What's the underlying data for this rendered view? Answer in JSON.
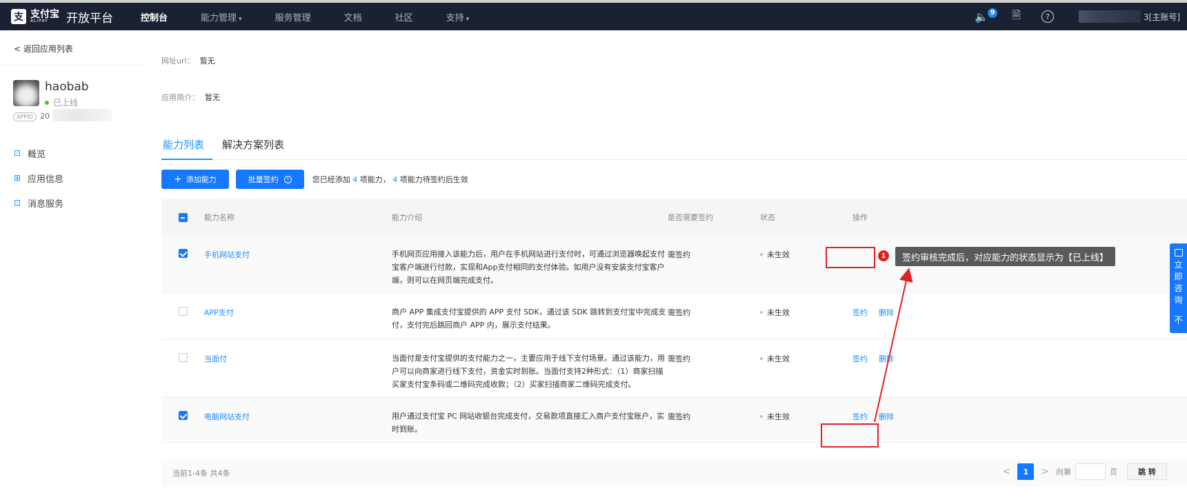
{
  "topbar": {
    "logo_mark": "支",
    "logo_zh": "支付宝",
    "logo_en": "ALIPAY",
    "platform": "开放平台",
    "nav": [
      {
        "label": "控制台",
        "caret": false,
        "active": true
      },
      {
        "label": "能力管理",
        "caret": true,
        "active": false
      },
      {
        "label": "服务管理",
        "caret": false,
        "active": false
      },
      {
        "label": "文档",
        "caret": false,
        "active": false
      },
      {
        "label": "社区",
        "caret": false,
        "active": false
      },
      {
        "label": "支持",
        "caret": true,
        "active": false
      }
    ],
    "notification_count": "9",
    "account_suffix": "3[主账号]",
    "speaker_glyph": "🔈",
    "doc_glyph": "🗎",
    "help_glyph": "?",
    "caret_glyph": "▾"
  },
  "sidebar": {
    "back_label": "返回应用列表",
    "back_glyph": "<",
    "app_name": "haobab",
    "app_status": "已上线",
    "appid_badge": "APPID",
    "appid_prefix": "20",
    "menu": [
      {
        "label": "概览",
        "icon": "monitor-icon",
        "glyph": "⊡"
      },
      {
        "label": "应用信息",
        "icon": "grid-icon",
        "glyph": "⊞"
      },
      {
        "label": "消息服务",
        "icon": "message-monitor-icon",
        "glyph": "⊡"
      }
    ]
  },
  "main": {
    "url_label": "网址url：",
    "url_value": "暂无",
    "intro_label": "应用简介：",
    "intro_value": "暂无",
    "tabs": [
      "能力列表",
      "解决方案列表"
    ],
    "add_button": "添加能力",
    "add_glyph": "+",
    "batch_button": "批量签约",
    "batch_glyph": "!",
    "summary_pre": "您已经添加",
    "summary_count1": "4",
    "summary_mid": "项能力，",
    "summary_count2": "4",
    "summary_post": "项能力待签约后生效",
    "columns": [
      "能力名称",
      "能力介绍",
      "是否需要签约",
      "状态",
      "操作"
    ],
    "rows": [
      {
        "name": "手机网站支付",
        "desc": "手机网页应用接入该能力后，用户在手机网站进行支付时，可通过浏览器唤起支付宝客户端进行付款，实现和App支付相同的支付体验。如用户没有安装支付宝客户端，则可以在网页端完成支付。",
        "sign": "需签约",
        "status": "未生效",
        "checked": true,
        "ops": []
      },
      {
        "name": "APP支付",
        "desc": "商户 APP 集成支付宝提供的 APP 支付 SDK，通过该 SDK 跳转到支付宝中完成支付，支付完后跳回商户 APP 内，展示支付结果。",
        "sign": "需签约",
        "status": "未生效",
        "checked": false,
        "ops": [
          "签约",
          "删除"
        ]
      },
      {
        "name": "当面付",
        "desc": "当面付是支付宝提供的支付能力之一，主要应用于线下支付场景。通过该能力，用户可以向商家进行线下支付，资金实时到账。当面付支持2种形式：（1）商家扫描买家支付宝条码或二维码完成收款；（2）买家扫描商家二维码完成支付。",
        "sign": "需签约",
        "status": "未生效",
        "checked": false,
        "ops": [
          "签约",
          "删除"
        ]
      },
      {
        "name": "电脑网站支付",
        "desc": "用户通过支付宝 PC 网站收银台完成支付，交易款项直接汇入商户支付宝账户，实时到账。",
        "sign": "需签约",
        "status": "未生效",
        "checked": true,
        "ops": [
          "签约",
          "删除"
        ]
      }
    ],
    "footer_count": "当前1-4条 共4条",
    "page_current": "1",
    "page_prev": "<",
    "page_next": ">",
    "goto_pre": "向第",
    "goto_post": "页",
    "goto_button": "跳 转"
  },
  "annotation": {
    "badge": "1",
    "tooltip": "签约审核完成后，对应能力的状态显示为【已上线】",
    "color": "#e02020"
  },
  "consult": {
    "chars": [
      "立",
      "即",
      "咨",
      "询"
    ],
    "bottom": "不"
  }
}
